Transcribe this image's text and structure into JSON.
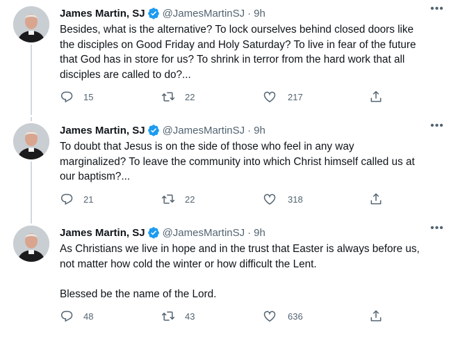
{
  "tweets": [
    {
      "author_name": "James Martin, SJ",
      "handle": "@JamesMartinSJ",
      "separator": "·",
      "time": "9h",
      "more_label": "•••",
      "text": "Besides, what is the alternative? To lock ourselves behind closed doors like\nthe disciples on Good Friday and Holy Saturday? To live in fear of the future\nthat God has in store for us? To shrink in terror from the hard work that all\ndisciples are called to do?...",
      "replies": "15",
      "retweets": "22",
      "likes": "217"
    },
    {
      "author_name": "James Martin, SJ",
      "handle": "@JamesMartinSJ",
      "separator": "·",
      "time": "9h",
      "more_label": "•••",
      "text": "To doubt that Jesus is on the side of those who feel in any way\nmarginalized? To leave the community into which Christ himself called us at\nour baptism?...",
      "replies": "21",
      "retweets": "22",
      "likes": "318"
    },
    {
      "author_name": "James Martin, SJ",
      "handle": "@JamesMartinSJ",
      "separator": "·",
      "time": "9h",
      "more_label": "•••",
      "text": "As Christians we live in hope and in the trust that Easter is always before us,\nnot matter how cold the winter or how difficult the Lent.\n\nBlessed be the name of the Lord.",
      "replies": "48",
      "retweets": "43",
      "likes": "636"
    }
  ],
  "icons": {
    "verified": "verified-badge-icon",
    "reply": "reply-icon",
    "retweet": "retweet-icon",
    "like": "heart-icon",
    "share": "share-icon",
    "more": "more-horizontal-icon"
  },
  "colors": {
    "verified_badge": "#1d9bf0",
    "secondary_text": "#536471",
    "thread_line": "#cfd9de"
  }
}
